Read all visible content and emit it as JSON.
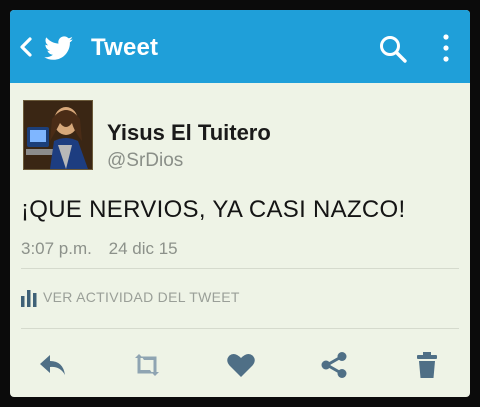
{
  "colors": {
    "header": "#1f9fd9",
    "background": "#eef3e6",
    "action_icons": "#4f6f86",
    "secondary_text": "#8c918a"
  },
  "header": {
    "title": "Tweet",
    "icons": [
      "back-chevron-icon",
      "twitter-bird-icon",
      "search-icon",
      "more-vertical-icon"
    ]
  },
  "tweet": {
    "display_name": "Yisus El Tuitero",
    "handle": "@SrDios",
    "text": "¡QUE NERVIOS, YA CASI NAZCO!",
    "time": "3:07 p.m.",
    "date": "24 dic 15",
    "activity_label": "VER ACTIVIDAD DEL TWEET"
  },
  "actions": {
    "icons": [
      "reply-icon",
      "retweet-icon",
      "like-icon",
      "share-icon",
      "delete-icon"
    ]
  }
}
